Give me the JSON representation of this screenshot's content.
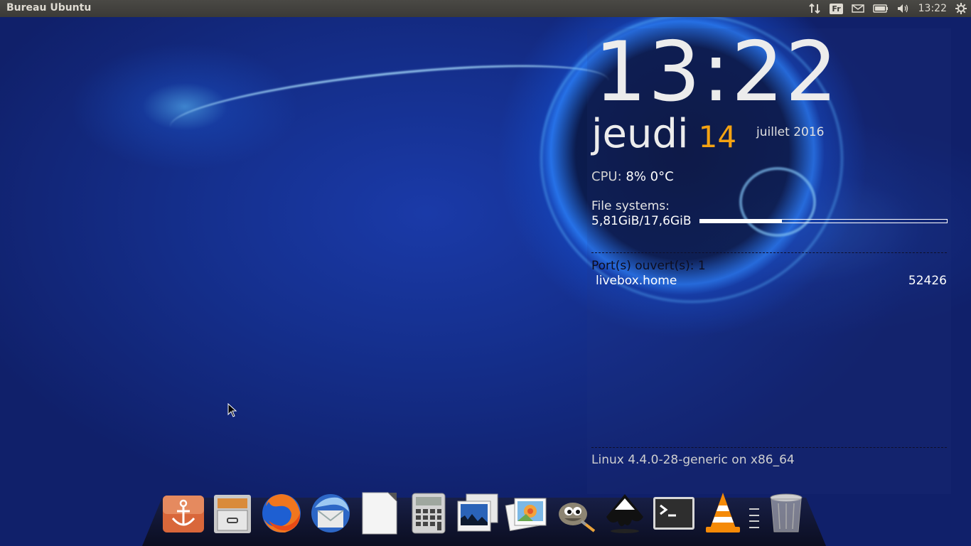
{
  "top_panel": {
    "title": "Bureau Ubuntu",
    "keyboard_layout": "Fr",
    "time": "13:22",
    "indicators": [
      "network-transfer-icon",
      "keyboard-layout",
      "mail-icon",
      "battery-icon",
      "volume-icon",
      "time",
      "session-gear-icon"
    ]
  },
  "conky": {
    "time": "13:22",
    "day_name": "jeudi",
    "day_number": "14",
    "month_year": "juillet 2016",
    "cpu_label": "CPU:",
    "cpu_value": "8% 0°C",
    "fs_label": "File systems:",
    "fs_value": "5,81GiB/17,6GiB",
    "fs_fraction": 0.33,
    "ports_label": "Port(s) ouvert(s): 1",
    "port_host": "livebox.home",
    "port_number": "52426",
    "kernel": "Linux 4.4.0-28-generic on x86_64",
    "accent_color": "#f5a312"
  },
  "dock": {
    "items": [
      {
        "name": "docky-anchor-icon"
      },
      {
        "name": "file-manager-icon"
      },
      {
        "name": "firefox-icon"
      },
      {
        "name": "thunderbird-icon"
      },
      {
        "name": "libreoffice-icon"
      },
      {
        "name": "calculator-icon"
      },
      {
        "name": "image-viewer-icon"
      },
      {
        "name": "shotwell-photos-icon"
      },
      {
        "name": "gimp-icon"
      },
      {
        "name": "inkscape-icon"
      },
      {
        "name": "terminal-icon"
      },
      {
        "name": "vlc-icon"
      },
      {
        "name": "trash-icon"
      }
    ]
  }
}
